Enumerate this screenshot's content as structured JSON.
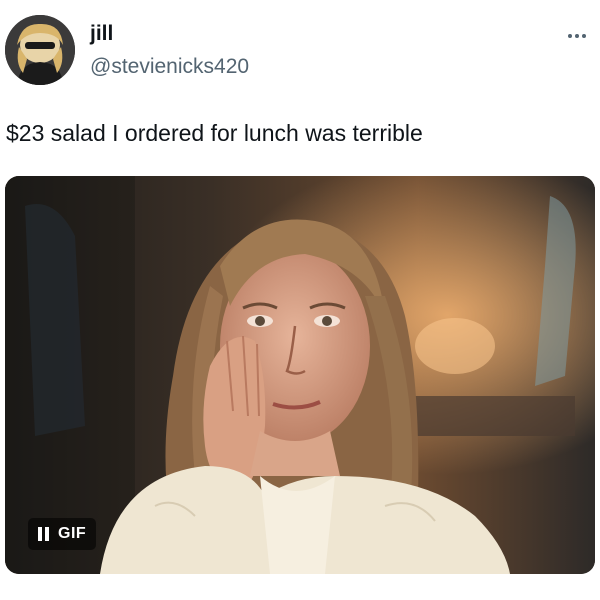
{
  "author": {
    "name": "jill",
    "handle": "@stevienicks420"
  },
  "tweet": {
    "text": "$23 salad I ordered for lunch was terrible"
  },
  "media": {
    "badge_label": "GIF",
    "playback_state": "playing"
  },
  "icons": {
    "more": "more-horizontal-icon",
    "pause": "pause-icon"
  }
}
